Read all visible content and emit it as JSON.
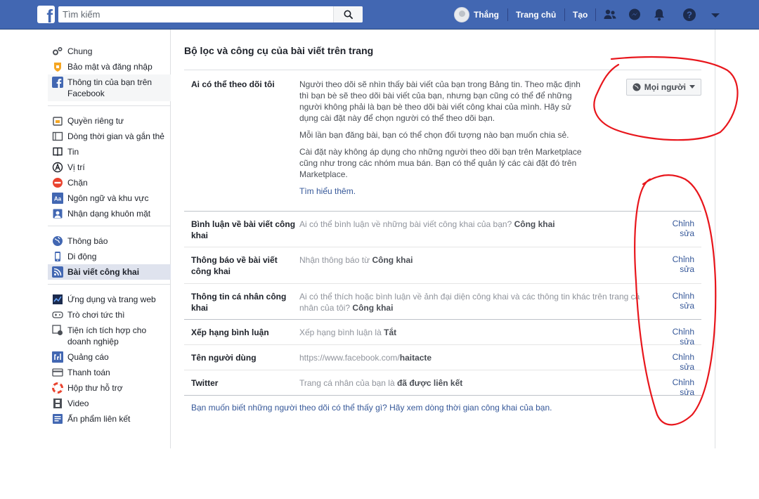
{
  "search": {
    "placeholder": "Tìm kiếm"
  },
  "topnav": {
    "user_name": "Thắng",
    "home": "Trang chủ",
    "create": "Tạo"
  },
  "sidebar": {
    "groups": [
      [
        {
          "label": "Chung",
          "icon": "gear-icon"
        },
        {
          "label": "Bảo mật và đăng nhập",
          "icon": "shield-icon"
        },
        {
          "label": "Thông tin của bạn trên Facebook",
          "icon": "facebook-icon"
        }
      ],
      [
        {
          "label": "Quyền riêng tư",
          "icon": "lock-icon"
        },
        {
          "label": "Dòng thời gian và gắn thẻ",
          "icon": "timeline-icon"
        },
        {
          "label": "Tin",
          "icon": "book-icon"
        },
        {
          "label": "Vị trí",
          "icon": "location-icon"
        },
        {
          "label": "Chặn",
          "icon": "block-icon"
        },
        {
          "label": "Ngôn ngữ và khu vực",
          "icon": "language-icon"
        },
        {
          "label": "Nhận dạng khuôn mặt",
          "icon": "face-icon"
        }
      ],
      [
        {
          "label": "Thông báo",
          "icon": "globe-icon"
        },
        {
          "label": "Di động",
          "icon": "mobile-icon"
        },
        {
          "label": "Bài viết công khai",
          "icon": "rss-icon"
        }
      ],
      [
        {
          "label": "Ứng dụng và trang web",
          "icon": "apps-icon"
        },
        {
          "label": "Trò chơi tức thì",
          "icon": "gamepad-icon"
        },
        {
          "label": "Tiện ích tích hợp cho doanh nghiệp",
          "icon": "integration-icon"
        },
        {
          "label": "Quảng cáo",
          "icon": "ads-icon"
        },
        {
          "label": "Thanh toán",
          "icon": "card-icon"
        },
        {
          "label": "Hộp thư hỗ trợ",
          "icon": "lifebuoy-icon"
        },
        {
          "label": "Video",
          "icon": "film-icon"
        },
        {
          "label": "Ấn phẩm liên kết",
          "icon": "publication-icon"
        }
      ]
    ]
  },
  "main": {
    "title": "Bộ lọc và công cụ của bài viết trên trang",
    "follow": {
      "label": "Ai có thể theo dõi tôi",
      "p1": "Người theo dõi sẽ nhìn thấy bài viết của bạn trong Bảng tin. Theo mặc định thì bạn bè sẽ theo dõi bài viết của bạn, nhưng bạn cũng có thể để những người không phải là bạn bè theo dõi bài viết công khai của mình. Hãy sử dụng cài đặt này để chọn người có thể theo dõi bạn.",
      "p2": "Mỗi lần bạn đăng bài, bạn có thể chọn đối tượng nào bạn muốn chia sẻ.",
      "p3": "Cài đặt này không áp dụng cho những người theo dõi bạn trên Marketplace cũng như trong các nhóm mua bán. Bạn có thể quản lý các cài đặt đó trên Marketplace.",
      "learn_more": "Tìm hiểu thêm.",
      "dropdown": "Mọi người"
    },
    "rows": [
      {
        "label": "Bình luận về bài viết công khai",
        "desc": "Ai có thể bình luận về những bài viết công khai của bạn?",
        "value": "Công khai",
        "action": "Chỉnh sửa"
      },
      {
        "label": "Thông báo về bài viết công khai",
        "desc": "Nhận thông báo từ",
        "value": "Công khai",
        "action": "Chỉnh sửa"
      },
      {
        "label": "Thông tin cá nhân công khai",
        "desc": "Ai có thể thích hoặc bình luận về ảnh đại diện công khai và các thông tin khác trên trang cá nhân của tôi?",
        "value": "Công khai",
        "action": "Chỉnh sửa"
      },
      {
        "label": "Xếp hạng bình luận",
        "desc": "Xếp hạng bình luận là",
        "value": "Tắt",
        "action": "Chỉnh sửa"
      },
      {
        "label": "Tên người dùng",
        "desc": "https://www.facebook.com/",
        "value": "haitacte",
        "action": "Chỉnh sửa"
      },
      {
        "label": "Twitter",
        "desc": "Trang cá nhân của bạn là",
        "value": "đã được liên kết",
        "action": "Chỉnh sửa"
      }
    ],
    "footer": "Bạn muốn biết những người theo dõi có thể thấy gì? Hãy xem dòng thời gian công khai của bạn."
  },
  "colors": {
    "brand": "#4267b2",
    "link": "#365899",
    "annotation": "#e8161c"
  }
}
